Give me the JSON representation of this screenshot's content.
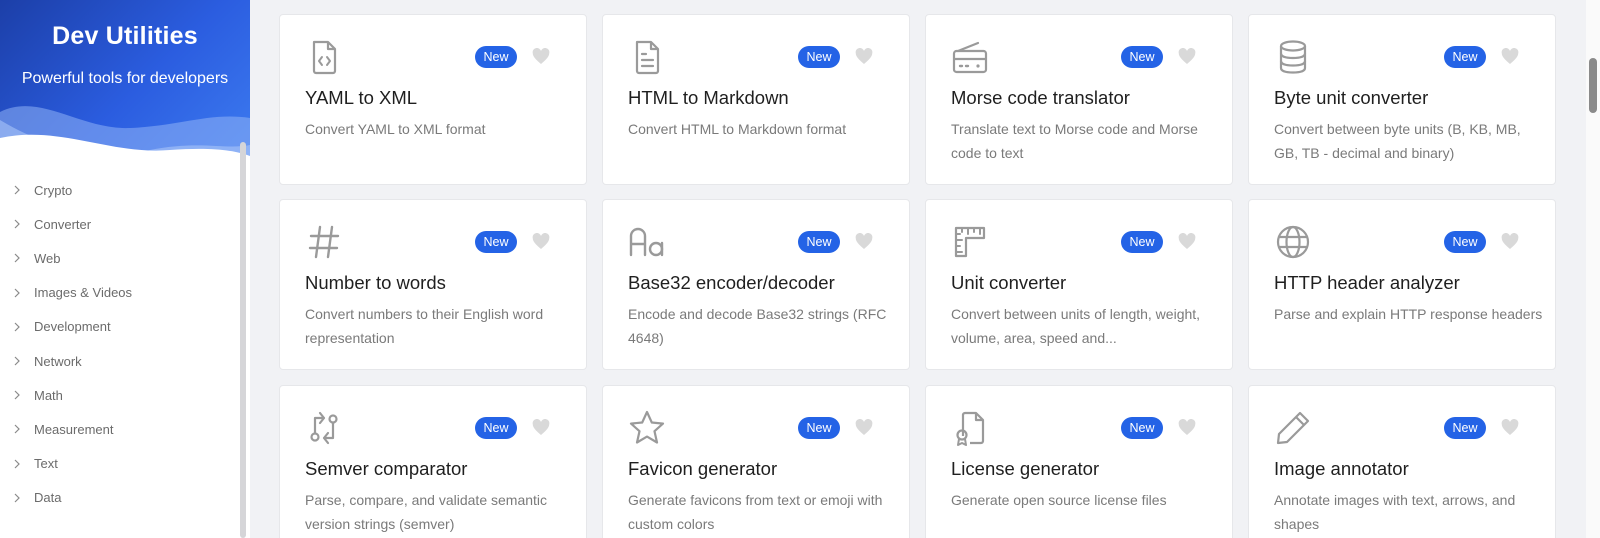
{
  "sidebar": {
    "title": "Dev Utilities",
    "subtitle": "Powerful tools for developers",
    "items": [
      {
        "label": "Crypto"
      },
      {
        "label": "Converter"
      },
      {
        "label": "Web"
      },
      {
        "label": "Images & Videos"
      },
      {
        "label": "Development"
      },
      {
        "label": "Network"
      },
      {
        "label": "Math"
      },
      {
        "label": "Measurement"
      },
      {
        "label": "Text"
      },
      {
        "label": "Data"
      }
    ]
  },
  "cards": [
    {
      "icon": "file-code-icon",
      "badge": "New",
      "title": "YAML to XML",
      "desc": "Convert YAML to XML format"
    },
    {
      "icon": "file-text-icon",
      "badge": "New",
      "title": "HTML to Markdown",
      "desc": "Convert HTML to Markdown format"
    },
    {
      "icon": "radio-icon",
      "badge": "New",
      "title": "Morse code translator",
      "desc": "Translate text to Morse code and Morse code to text"
    },
    {
      "icon": "database-icon",
      "badge": "New",
      "title": "Byte unit converter",
      "desc": "Convert between byte units (B, KB, MB, GB, TB - decimal and binary)"
    },
    {
      "icon": "hash-icon",
      "badge": "New",
      "title": "Number to words",
      "desc": "Convert numbers to their English word representation"
    },
    {
      "icon": "letter-case-icon",
      "badge": "New",
      "title": "Base32 encoder/decoder",
      "desc": "Encode and decode Base32 strings (RFC 4648)"
    },
    {
      "icon": "ruler-icon",
      "badge": "New",
      "title": "Unit converter",
      "desc": "Convert between units of length, weight, volume, area, speed and..."
    },
    {
      "icon": "globe-icon",
      "badge": "New",
      "title": "HTTP header analyzer",
      "desc": "Parse and explain HTTP response headers"
    },
    {
      "icon": "git-compare-icon",
      "badge": "New",
      "title": "Semver comparator",
      "desc": "Parse, compare, and validate semantic version strings (semver)"
    },
    {
      "icon": "star-icon",
      "badge": "New",
      "title": "Favicon generator",
      "desc": "Generate favicons from text or emoji with custom colors"
    },
    {
      "icon": "license-icon",
      "badge": "New",
      "title": "License generator",
      "desc": "Generate open source license files"
    },
    {
      "icon": "pencil-icon",
      "badge": "New",
      "title": "Image annotator",
      "desc": "Annotate images with text, arrows, and shapes"
    }
  ],
  "colors": {
    "accent": "#2463e6",
    "hero_start": "#1c3fa8",
    "hero_end": "#3d7bf0",
    "icon": "#9a9a9a",
    "background": "#f1f2f5"
  }
}
